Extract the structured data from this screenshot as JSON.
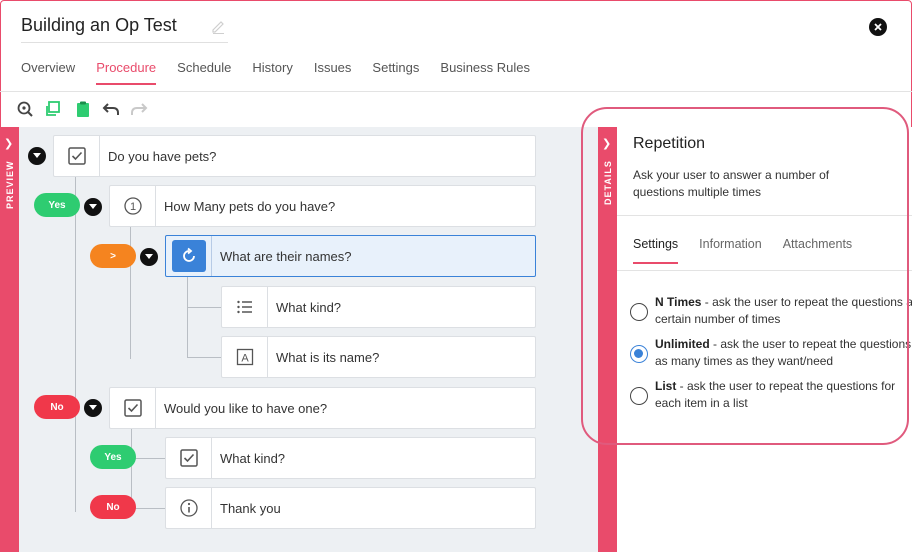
{
  "header": {
    "title": "Building an Op Test",
    "tabs": [
      {
        "label": "Overview",
        "active": false
      },
      {
        "label": "Procedure",
        "active": true
      },
      {
        "label": "Schedule",
        "active": false
      },
      {
        "label": "History",
        "active": false
      },
      {
        "label": "Issues",
        "active": false
      },
      {
        "label": "Settings",
        "active": false
      },
      {
        "label": "Business Rules",
        "active": false
      }
    ]
  },
  "toolbar": {
    "icons": [
      "zoom-reset-icon",
      "copy-icon",
      "clipboard-icon",
      "undo-icon",
      "redo-icon"
    ]
  },
  "preview_strip": {
    "label": "PREVIEW"
  },
  "details_strip": {
    "label": "DETAILS"
  },
  "tree": {
    "nodes": [
      {
        "label": "Do you have pets?",
        "icon": "checkbox-icon"
      },
      {
        "label": "How Many pets do you have?",
        "icon": "number-icon"
      },
      {
        "label": "What are their names?",
        "icon": "repeat-icon"
      },
      {
        "label": "What kind?",
        "icon": "list-icon"
      },
      {
        "label": "What is its name?",
        "icon": "text-field-icon"
      },
      {
        "label": "Would you like to have one?",
        "icon": "checkbox-icon"
      },
      {
        "label": "What kind?",
        "icon": "checkbox-icon"
      },
      {
        "label": "Thank you",
        "icon": "info-icon"
      }
    ],
    "branches": [
      {
        "label": "Yes",
        "color": "#2ecc71"
      },
      {
        "label": ">",
        "color": "#f5841f"
      },
      {
        "label": "No",
        "color": "#f0384a"
      },
      {
        "label": "Yes",
        "color": "#2ecc71"
      },
      {
        "label": "No",
        "color": "#f0384a"
      }
    ]
  },
  "details": {
    "title": "Repetition",
    "description": "Ask your user to answer a number of questions multiple times",
    "tabs": [
      {
        "label": "Settings",
        "active": true
      },
      {
        "label": "Information",
        "active": false
      },
      {
        "label": "Attachments",
        "active": false
      }
    ],
    "options": [
      {
        "name": "N Times",
        "text": " - ask the user to repeat the questions a certain number of times",
        "selected": false
      },
      {
        "name": "Unlimited",
        "text": " - ask the user to repeat the questions as many times as they want/need",
        "selected": true
      },
      {
        "name": "List",
        "text": " - ask the user to repeat the questions for each item in a list",
        "selected": false
      }
    ]
  },
  "colors": {
    "accent": "#e94b6b",
    "selected_blue": "#3a82d8"
  }
}
